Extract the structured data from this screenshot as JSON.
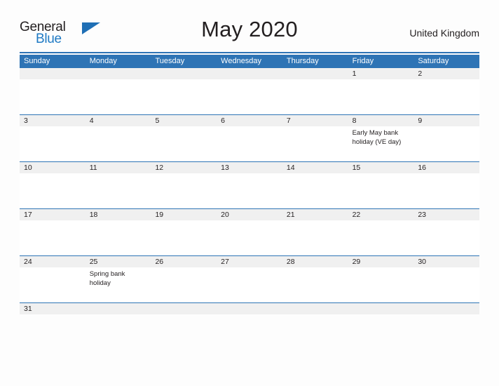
{
  "logo": {
    "word_one": "General",
    "word_two": "Blue",
    "flag_icon": "triangle-flag-icon",
    "accent_color": "#1f6fb5"
  },
  "header": {
    "title": "May 2020",
    "country": "United Kingdom",
    "rule_color": "#2e74b5"
  },
  "calendar": {
    "month": "May",
    "year": "2020",
    "header_bg": "#2e74b5",
    "date_band_bg": "#f0f0f0",
    "day_names": [
      "Sunday",
      "Monday",
      "Tuesday",
      "Wednesday",
      "Thursday",
      "Friday",
      "Saturday"
    ],
    "weeks": [
      {
        "dates": [
          "",
          "",
          "",
          "",
          "",
          "1",
          "2"
        ],
        "events": [
          "",
          "",
          "",
          "",
          "",
          "",
          ""
        ]
      },
      {
        "dates": [
          "3",
          "4",
          "5",
          "6",
          "7",
          "8",
          "9"
        ],
        "events": [
          "",
          "",
          "",
          "",
          "",
          "Early May bank holiday (VE day)",
          ""
        ]
      },
      {
        "dates": [
          "10",
          "11",
          "12",
          "13",
          "14",
          "15",
          "16"
        ],
        "events": [
          "",
          "",
          "",
          "",
          "",
          "",
          ""
        ]
      },
      {
        "dates": [
          "17",
          "18",
          "19",
          "20",
          "21",
          "22",
          "23"
        ],
        "events": [
          "",
          "",
          "",
          "",
          "",
          "",
          ""
        ]
      },
      {
        "dates": [
          "24",
          "25",
          "26",
          "27",
          "28",
          "29",
          "30"
        ],
        "events": [
          "",
          "Spring bank holiday",
          "",
          "",
          "",
          "",
          ""
        ]
      },
      {
        "dates": [
          "31",
          "",
          "",
          "",
          "",
          "",
          ""
        ],
        "events": [
          "",
          "",
          "",
          "",
          "",
          "",
          ""
        ]
      }
    ]
  }
}
